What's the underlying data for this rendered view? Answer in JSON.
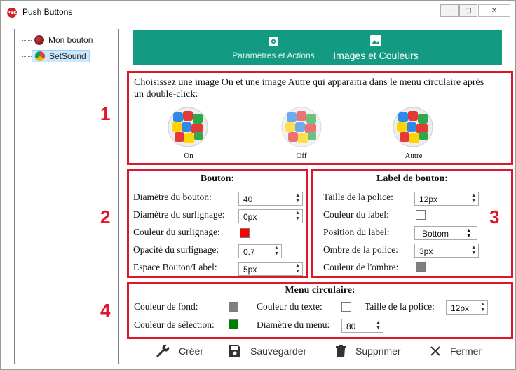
{
  "window": {
    "title": "Push Buttons",
    "app_icon_text": "PBK"
  },
  "tree": {
    "items": [
      {
        "label": "Mon bouton"
      },
      {
        "label": "SetSound"
      }
    ]
  },
  "tabs": [
    {
      "label": "Paramètres et Actions"
    },
    {
      "label": "Images et Couleurs"
    }
  ],
  "sections": {
    "images": {
      "number": "1",
      "description": "Choisissez une image On et une image Autre qui apparaitra dans le menu circulaire après un double-click:",
      "images": [
        {
          "label": "On"
        },
        {
          "label": "Off"
        },
        {
          "label": "Autre"
        }
      ]
    },
    "bouton": {
      "number": "2",
      "title": "Bouton:",
      "rows": [
        {
          "label": "Diamètre du bouton:",
          "value": "40"
        },
        {
          "label": "Diamètre du surlignage:",
          "value": "0px"
        },
        {
          "label": "Couleur du surlignage:",
          "color": "#ff0000"
        },
        {
          "label": "Opacité du surlignage:",
          "value": "0.7"
        },
        {
          "label": "Espace Bouton/Label:",
          "value": "5px"
        }
      ]
    },
    "label": {
      "number": "3",
      "title": "Label de bouton:",
      "rows": [
        {
          "label": "Taille de la police:",
          "value": "12px"
        },
        {
          "label": "Couleur du label:",
          "color": "#ffffff"
        },
        {
          "label": "Position du label:",
          "value": "Bottom"
        },
        {
          "label": "Ombre de la police:",
          "value": "3px"
        },
        {
          "label": "Couleur de l'ombre:",
          "color": "#808080"
        }
      ]
    },
    "menu": {
      "number": "4",
      "title": "Menu circulaire:",
      "fond_label": "Couleur de fond:",
      "fond_color": "#808080",
      "texte_label": "Couleur du texte:",
      "texte_color": "#ffffff",
      "taille_label": "Taille de la police:",
      "taille_value": "12px",
      "selection_label": "Couleur de sélection:",
      "selection_color": "#008000",
      "diametre_label": "Diamètre du menu:",
      "diametre_value": "80"
    }
  },
  "actions": [
    {
      "label": "Créer"
    },
    {
      "label": "Sauvegarder"
    },
    {
      "label": "Supprimer"
    },
    {
      "label": "Fermer"
    }
  ],
  "colors": {
    "tab_bar": "#129a83",
    "annotation": "#e0142b"
  }
}
